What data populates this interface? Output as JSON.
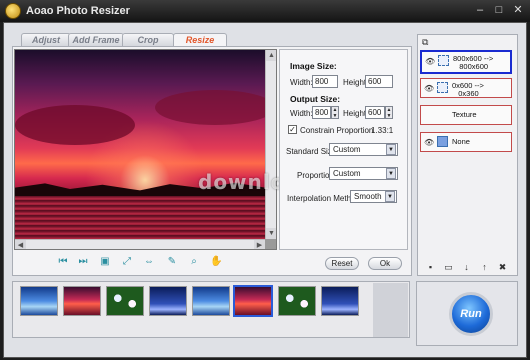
{
  "window": {
    "title": "Aoao Photo Resizer",
    "minimize": "–",
    "maximize": "□",
    "close": "✕"
  },
  "tabs": [
    {
      "label": "Adjust"
    },
    {
      "label": "Add Frame"
    },
    {
      "label": "Crop"
    },
    {
      "label": "Resize",
      "active": true
    }
  ],
  "watermark": "download",
  "settings": {
    "image_size_header": "Image Size:",
    "width_label": "Width:",
    "height_label": "Height:",
    "image_width": "800",
    "image_height": "600",
    "output_size_header": "Output Size:",
    "out_width": "800",
    "out_height": "600",
    "constrain_label": "Constrain Proportion",
    "constrain_checked": true,
    "ratio": "1.33:1",
    "standard_size_label": "Standard Size:",
    "standard_size_value": "Custom",
    "proportion_label": "Proportion:",
    "proportion_value": "Custom",
    "interpolation_label": "Interpolation Methods:",
    "interpolation_value": "Smooth"
  },
  "buttons": {
    "reset": "Reset",
    "ok": "Ok",
    "run": "Run"
  },
  "toolbar_icons": [
    "first-icon",
    "last-icon",
    "fit-icon",
    "fullscreen-icon",
    "swap-icon",
    "pick-icon",
    "zoom-icon",
    "hand-icon"
  ],
  "right_panel": {
    "items": [
      {
        "line1": "800x600 -->",
        "line2": "800x600",
        "selected": true,
        "icon": "resize-icon"
      },
      {
        "line1": "0x600 -->",
        "line2": "0x360",
        "selected": false,
        "icon": "resize-icon"
      },
      {
        "line1": "Texture",
        "line2": "",
        "selected": false,
        "icon": "none"
      },
      {
        "line1": "None",
        "line2": "",
        "selected": false,
        "icon": "frame-icon"
      }
    ],
    "tool_icons": [
      "save-icon",
      "open-icon",
      "down-icon",
      "up-icon",
      "delete-icon"
    ]
  },
  "thumbnails": [
    {
      "kind": "sky"
    },
    {
      "kind": "sunset"
    },
    {
      "kind": "flowers"
    },
    {
      "kind": "night"
    },
    {
      "kind": "sky"
    },
    {
      "kind": "sunset",
      "selected": true
    },
    {
      "kind": "flowers"
    },
    {
      "kind": "night"
    }
  ]
}
